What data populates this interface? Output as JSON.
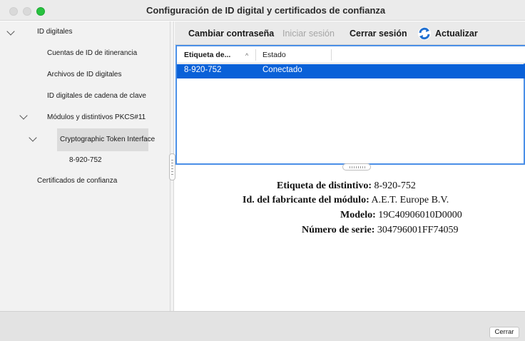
{
  "window": {
    "title": "Configuración de ID digital y certificados de confianza"
  },
  "sidebar": {
    "items": [
      {
        "label": "ID digitales",
        "expanded": true
      },
      {
        "label": "Cuentas de ID de itinerancia"
      },
      {
        "label": "Archivos de ID digitales"
      },
      {
        "label": "ID digitales de cadena de clave"
      },
      {
        "label": "Módulos y distintivos PKCS#11",
        "expanded": true
      },
      {
        "label": "Cryptographic Token Interface",
        "expanded": true,
        "selected": true
      },
      {
        "label": "8-920-752"
      },
      {
        "label": "Certificados de confianza"
      }
    ]
  },
  "toolbar": {
    "change_password": "Cambiar contraseña",
    "login": "Iniciar sesión",
    "logout": "Cerrar sesión",
    "refresh": "Actualizar",
    "refresh_icon": "refresh-icon",
    "accent": "#1f6fd1"
  },
  "table": {
    "columns": [
      "Etiqueta de...",
      "Estado"
    ],
    "sort_indicator": "^",
    "rows": [
      {
        "label": "8-920-752",
        "status": "Conectado",
        "selected": true
      }
    ],
    "selection_color": "#0a61d8",
    "focus_border": "#4a8fe7"
  },
  "details": {
    "token_label": {
      "label": "Etiqueta de distintivo:",
      "value": "8-920-752"
    },
    "manufacturer": {
      "label": "Id. del fabricante del módulo:",
      "value": "A.E.T. Europe B.V."
    },
    "model": {
      "label": "Modelo:",
      "value": "19C40906010D0000"
    },
    "serial": {
      "label": "Número de serie:",
      "value": "304796001FF74059"
    }
  },
  "footer": {
    "close_label": "Cerrar"
  }
}
